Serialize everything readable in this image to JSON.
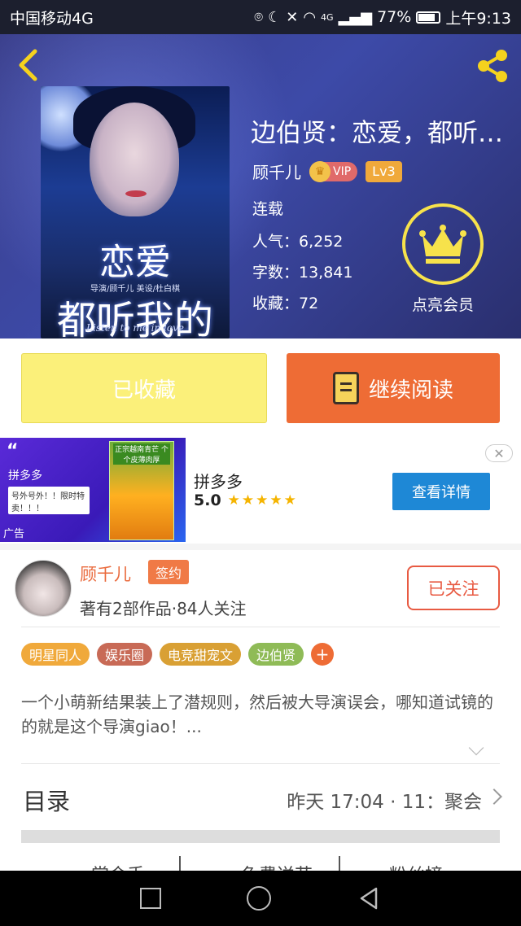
{
  "status_bar": {
    "carrier": "中国移动4G",
    "battery": "77%",
    "time": "上午9:13",
    "network": "4G",
    "icons": [
      "location-icon",
      "moon-icon",
      "mute-icon",
      "wifi-icon",
      "signal-icon",
      "battery-icon"
    ]
  },
  "header": {
    "back_icon": "back-arrow-icon",
    "share_icon": "share-icon",
    "cover": {
      "title_line1": "恋爱",
      "title_line2": "都听我的",
      "credit": "导演/顾千儿    美设/杜白棋",
      "english": "Listen to me in love"
    },
    "title": "边伯贤：恋爱，都听…",
    "author": "顾千儿",
    "vip_badge": "VIP",
    "level_badge": "Lv3",
    "status": "连载",
    "popularity": "人气：6,252",
    "word_count": "字数：13,841",
    "favorites": "收藏：72",
    "member_label": "点亮会员"
  },
  "actions": {
    "favorited_label": "已收藏",
    "continue_label": "继续阅读"
  },
  "ad": {
    "left_brand": "拼多多",
    "bubble": "号外号外！！限时特卖！！！",
    "ad_tag": "广告",
    "product_text": "正宗越南青芒 个个皮薄肉厚",
    "brand": "拼多多",
    "rating": "5.0",
    "stars": "★★★★★",
    "cta": "查看详情",
    "close": "✕"
  },
  "author_card": {
    "name": "顾千儿",
    "signed_badge": "签约",
    "info": "著有2部作品·84人关注",
    "follow_label": "已关注",
    "tags": [
      {
        "label": "明星同人",
        "color": "#f0a93b"
      },
      {
        "label": "娱乐圈",
        "color": "#c86a56"
      },
      {
        "label": "电竞甜宠文",
        "color": "#d9a034"
      },
      {
        "label": "边伯贤",
        "color": "#8fbb57"
      }
    ],
    "tag_more": "+",
    "description": "一个小萌新结果装上了潜规则，然后被大导演误会，哪知道试镜的的就是这个导演giao！...",
    "toc_label": "目录",
    "toc_latest": "昨天 17:04 · 11：聚会",
    "bottom_tabs": [
      "掌金手",
      "免费送花",
      "粉丝榜"
    ]
  },
  "nav": {
    "recent_icon": "recent-apps-icon",
    "home_icon": "home-icon",
    "back_icon": "back-triangle-icon"
  }
}
